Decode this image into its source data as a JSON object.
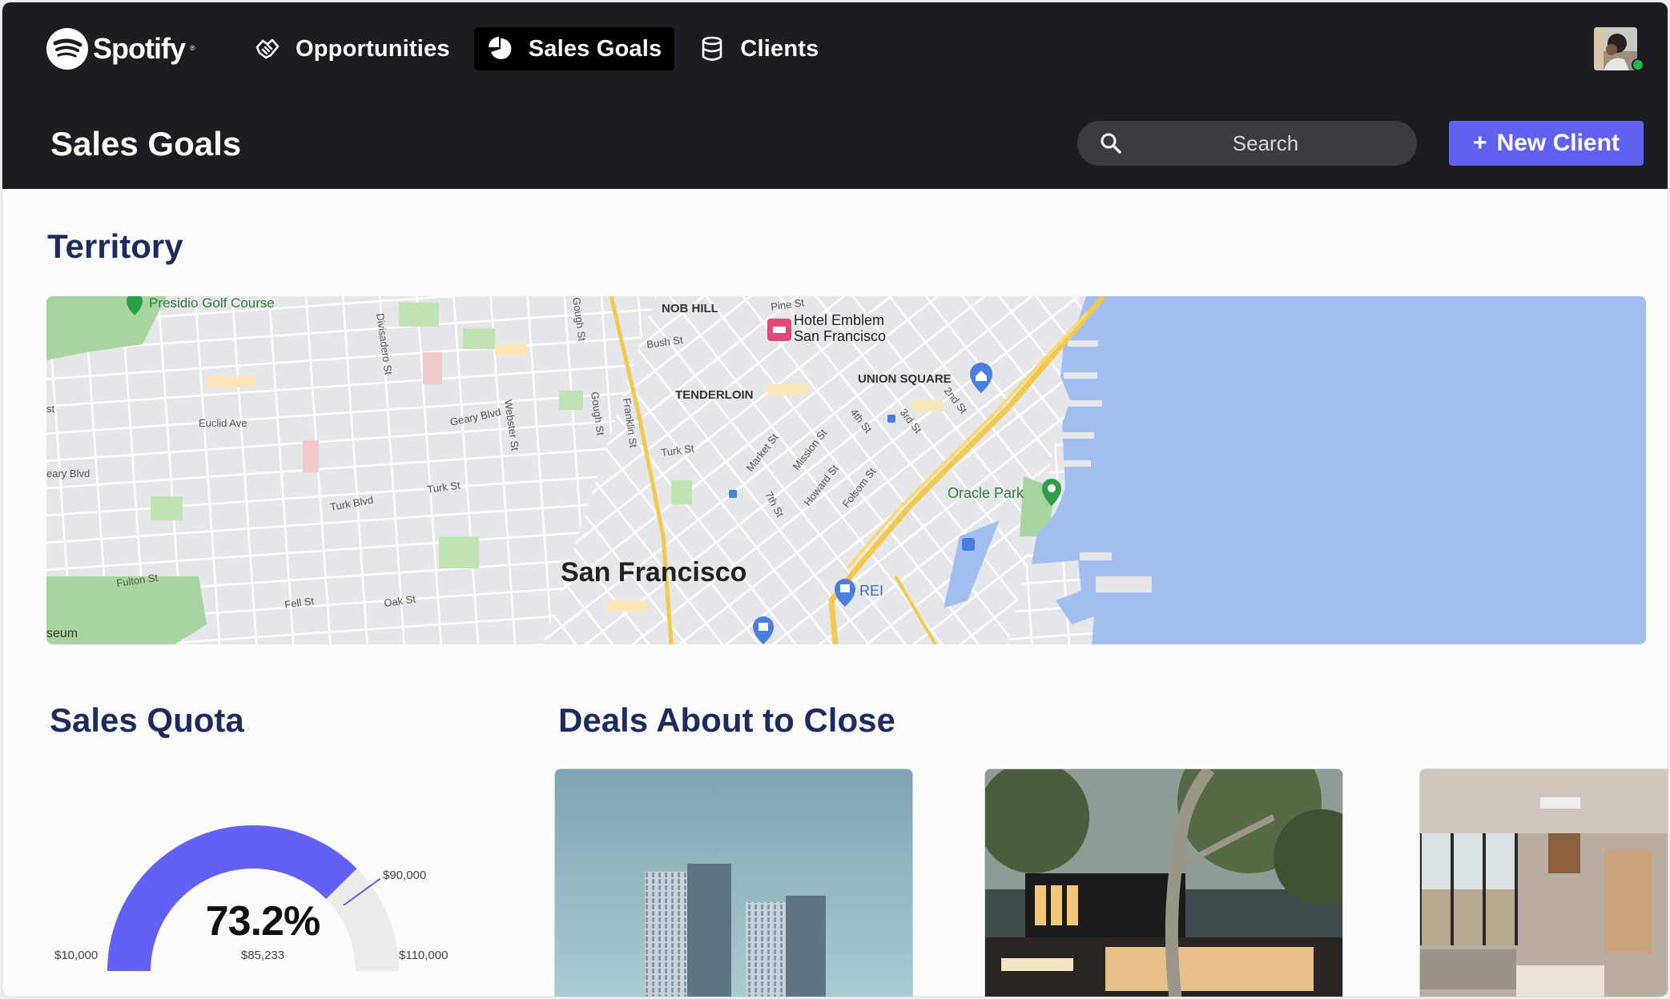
{
  "app": {
    "brand": "Spotify"
  },
  "nav": {
    "items": [
      {
        "label": "Opportunities",
        "icon": "handshake-icon",
        "active": false
      },
      {
        "label": "Sales Goals",
        "icon": "pie-chart-icon",
        "active": true
      },
      {
        "label": "Clients",
        "icon": "database-icon",
        "active": false
      }
    ]
  },
  "header": {
    "title": "Sales Goals",
    "search_placeholder": "Search",
    "new_client_label": "New Client",
    "new_client_plus": "+"
  },
  "territory": {
    "title": "Territory",
    "map_labels": {
      "city": "San Francisco",
      "nob_hill": "NOB HILL",
      "union_square": "UNION SQUARE",
      "tenderloin": "TENDERLOIN",
      "hotel": "Hotel Emblem",
      "hotel_2": "San Francisco",
      "oracle": "Oracle Park",
      "presidio": "Presidio Golf Course",
      "rei": "REI",
      "euclid": "Euclid Ave",
      "geary": "Geary Blvd",
      "geary_w": "eary Blvd",
      "turk_blvd": "Turk Blvd",
      "turk_st": "Turk St",
      "turk_st_2": "Turk St",
      "fulton": "Fulton St",
      "fell": "Fell St",
      "oak": "Oak St",
      "pine": "Pine St",
      "bush": "Bush St",
      "market": "Market St",
      "mission": "Mission St",
      "howard": "Howard St",
      "folsom": "Folsom St",
      "fourth": "4th St",
      "third": "3rd St",
      "second": "2nd St",
      "seventh": "7th St",
      "divisadero": "Divisadero St",
      "webster": "Webster St",
      "gough": "Gough St",
      "gough_2": "Gough St",
      "franklin": "Franklin St",
      "museum": "seum",
      "st_left": "st"
    }
  },
  "quota": {
    "title": "Sales Quota",
    "percent": "73.2%",
    "current": "$85,233",
    "min": "$10,000",
    "max": "$110,000",
    "target": "$90,000",
    "fraction": 0.752,
    "colors": {
      "fill": "#6161f5",
      "track": "#ececea",
      "marker": "#5b5bf0"
    }
  },
  "deals": {
    "title": "Deals About to Close"
  },
  "colors": {
    "header_bg": "#1b1d22",
    "accent": "#6161ef",
    "title_navy": "#1e2b5e",
    "water": "#a3bff2",
    "status_online": "#1db954"
  }
}
